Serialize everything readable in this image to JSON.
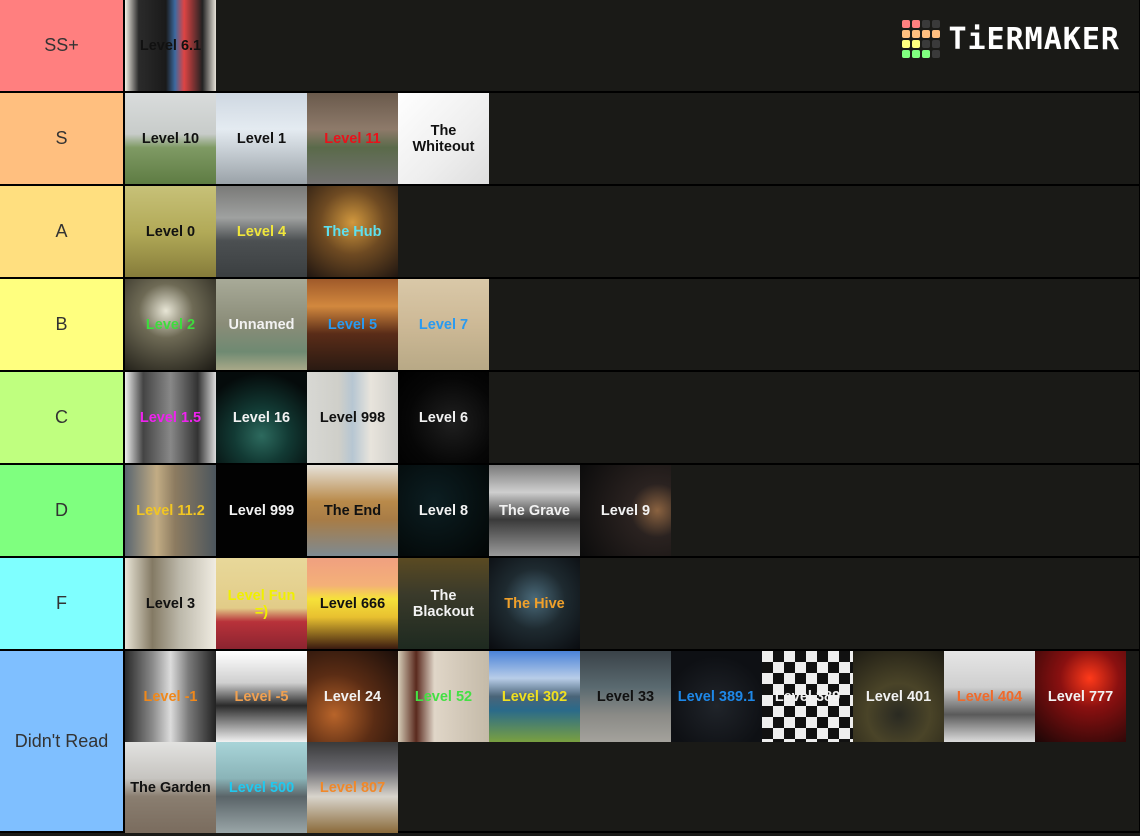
{
  "logo": {
    "text": "TiERMAKER",
    "grid_colors": [
      "#ff7f7f",
      "#ff7f7f",
      "#3a3a3a",
      "#3a3a3a",
      "#ffbf7f",
      "#ffbf7f",
      "#ffbf7f",
      "#ffbf7f",
      "#ffff7f",
      "#ffff7f",
      "#3a3a3a",
      "#3a3a3a",
      "#7fff7f",
      "#7fff7f",
      "#7fff7f",
      "#3a3a3a"
    ]
  },
  "tiers": [
    {
      "label": "SS+",
      "color": "#ff7f7f",
      "items": [
        {
          "name": "Level 6.1",
          "text_color": "#111111",
          "bg": "linear-gradient(90deg,#f3efe6 0%,#2b2b2b 15%,#1a1a1a 45%,#3c6aa0 55%,#d44 65%,#222 85%,#e6e2d8 100%)"
        }
      ]
    },
    {
      "label": "S",
      "color": "#ffbf7f",
      "items": [
        {
          "name": "Level 10",
          "text_color": "#111111",
          "bg": "linear-gradient(180deg,#d9dcdc 0%,#c8ccca 45%,#7f9a64 60%,#5e7c43 100%)"
        },
        {
          "name": "Level 1",
          "text_color": "#111111",
          "bg": "linear-gradient(180deg,#cfd8e2 0%,#e4ebf1 40%,#9aa2a8 100%)"
        },
        {
          "name": "Level 11",
          "text_color": "#e8121b",
          "bg": "linear-gradient(180deg,#6a5a4c 0%,#8e7a6a 40%,#5a6a4a 60%,#737171 100%)"
        },
        {
          "name": "The\nWhiteout",
          "text_color": "#111111",
          "bg": "linear-gradient(135deg,#ffffff 0%,#eeeeee 60%,#dedede 100%)"
        }
      ]
    },
    {
      "label": "A",
      "color": "#ffdf7f",
      "items": [
        {
          "name": "Level 0",
          "text_color": "#111111",
          "bg": "linear-gradient(180deg,#c7c178 0%,#b2aa58 50%,#867c3a 100%)"
        },
        {
          "name": "Level 4",
          "text_color": "#f0e63c",
          "bg": "linear-gradient(180deg,#7a7a78 0%,#9fa1a0 35%,#4c5052 60%,#3b3f41 100%)"
        },
        {
          "name": "The Hub",
          "text_color": "#5ee0ee",
          "bg": "radial-gradient(circle at 50% 40%,#d1983e 0%,#6e4a22 45%,#201611 100%)"
        }
      ]
    },
    {
      "label": "B",
      "color": "#ffff7f",
      "items": [
        {
          "name": "Level 2",
          "text_color": "#3ddc3d",
          "bg": "radial-gradient(circle at 45% 35%,#e8e6d6 0%,#6e6a55 35%,#1c1a14 100%)"
        },
        {
          "name": "Unnamed",
          "text_color": "#f2f2f2",
          "bg": "linear-gradient(180deg,#a8aa98 0%,#8a8c78 50%,#6f8a72 80%,#a8a888 100%)"
        },
        {
          "name": "Level 5",
          "text_color": "#2a9af0",
          "bg": "linear-gradient(180deg,#a05a2a 0%,#d2883e 30%,#5a2c18 60%,#2a1a12 100%)"
        },
        {
          "name": "Level 7",
          "text_color": "#2a9af0",
          "bg": "linear-gradient(180deg,#d9c8a8 0%,#cdb996 50%,#b8a986 100%)"
        }
      ]
    },
    {
      "label": "C",
      "color": "#bfff7f",
      "items": [
        {
          "name": "Level 1.5",
          "text_color": "#ee22ee",
          "bg": "linear-gradient(90deg,#eeeeee 0%,#444 20%,#888 50%,#333 80%,#ddd 100%)"
        },
        {
          "name": "Level 16",
          "text_color": "#f2f2f2",
          "bg": "radial-gradient(circle at 50% 70%,#2d6a5e 0%,#123a34 35%,#050b0b 80%)"
        },
        {
          "name": "Level 998",
          "text_color": "#111111",
          "bg": "linear-gradient(90deg,#d8d8d4 0%,#cfcfc9 35%,#b6c6d2 50%,#e8e4dc 70%,#cfcfcb 100%)"
        },
        {
          "name": "Level 6",
          "text_color": "#f2f2f2",
          "bg": "radial-gradient(circle at 60% 55%,#1f1f1f 0%,#060606 60%,#000 100%)"
        }
      ]
    },
    {
      "label": "D",
      "color": "#7fff7f",
      "items": [
        {
          "name": "Level 11.2",
          "text_color": "#f2c622",
          "bg": "linear-gradient(90deg,#5a6670 0%,#c2ac84 35%,#8c7b60 55%,#4c565e 100%)"
        },
        {
          "name": "Level 999",
          "text_color": "#f2f2f2",
          "bg": "#020202"
        },
        {
          "name": "The End",
          "text_color": "#111111",
          "bg": "linear-gradient(180deg,#e6e2da 0%,#b98a4a 40%,#a87c46 60%,#7e8a92 100%)"
        },
        {
          "name": "Level 8",
          "text_color": "#f2f2f2",
          "bg": "radial-gradient(circle at 40% 40%,#0c1e22 0%,#060f10 60%,#020505 100%)"
        },
        {
          "name": "The Grave",
          "text_color": "#f2f2f2",
          "bg": "linear-gradient(180deg,#7a7a7a 0%,#cfcfcf 30%,#3a3a3a 60%,#9a9a9a 100%)"
        },
        {
          "name": "Level 9",
          "text_color": "#f2f2f2",
          "bg": "radial-gradient(circle at 85% 50%,#8a6240 0%,#2a2220 30%,#0c0c0c 100%)"
        }
      ]
    },
    {
      "label": "F",
      "color": "#7fffff",
      "items": [
        {
          "name": "Level 3",
          "text_color": "#111111",
          "bg": "linear-gradient(90deg,#e8e4d6 0%,#847a64 30%,#bcb8aa 60%,#f0ece2 100%)"
        },
        {
          "name": "Level Fun\n=)",
          "text_color": "#f0f000",
          "bg": "linear-gradient(180deg,#e8d89a 0%,#e2cc88 55%,#b8323a 70%,#8c2430 100%)"
        },
        {
          "name": "Level 666",
          "text_color": "#111111",
          "bg": "linear-gradient(180deg,#f0a080 0%,#f4b078 30%,#f6e23a 45%,#e8c030 65%,#3a1a10 100%)"
        },
        {
          "name": "The\nBlackout",
          "text_color": "#f2f2f2",
          "bg": "linear-gradient(180deg,#5a4a22 0%,#3a3a2a 40%,#1e2a20 100%)"
        },
        {
          "name": "The Hive",
          "text_color": "#f0a02a",
          "bg": "radial-gradient(circle at 50% 45%,#4a6a7a 0%,#1e2a30 45%,#0a0c10 100%)"
        }
      ]
    },
    {
      "label": "Didn't Read",
      "color": "#7fbfff",
      "items": [
        {
          "name": "Level -1",
          "text_color": "#f0881a",
          "bg": "linear-gradient(90deg,#2a2a2a 0%,#8a8a8a 30%,#dcdcdc 50%,#7a7a7a 70%,#222 100%)"
        },
        {
          "name": "Level -5",
          "text_color": "#f0a050",
          "bg": "linear-gradient(180deg,#ffffff 0%,#cfcfcf 35%,#2a2a2a 60%,#f2f2f2 100%)"
        },
        {
          "name": "Level 24",
          "text_color": "#f2f2f2",
          "bg": "radial-gradient(circle at 30% 70%,#b8642a 0%,#5a2c14 45%,#1a0e0a 100%)"
        },
        {
          "name": "Level 52",
          "text_color": "#44e044",
          "bg": "linear-gradient(90deg,#d6cdb8 0%,#5a2a1e 20%,#e0d6c8 40%,#c4baa8 100%)"
        },
        {
          "name": "Level 302",
          "text_color": "#f0e020",
          "bg": "linear-gradient(180deg,#4a82d8 0%,#b8cde8 30%,#4a6478 50%,#2a6a8a 65%,#7aa040 100%)"
        },
        {
          "name": "Level 33",
          "text_color": "#111111",
          "bg": "linear-gradient(180deg,#3a4248 0%,#5a6a70 40%,#8a8a86 70%,#a4a29c 100%)"
        },
        {
          "name": "Level 389.1",
          "text_color": "#1e88e8",
          "bg": "radial-gradient(circle at 50% 60%,#20242a 0%,#0e1014 70%)"
        },
        {
          "name": "Level 389",
          "text_color": "#f2f2f2",
          "bg": "repeating-conic-gradient(#111 0% 25%, #eee 0% 50%) 0 0/22px 22px"
        },
        {
          "name": "Level 401",
          "text_color": "#f2f2f2",
          "bg": "radial-gradient(circle at 50% 70%,#2a2a22 0%,#4a4428 40%,#1e1c14 100%)"
        },
        {
          "name": "Level 404",
          "text_color": "#f06a2a",
          "bg": "linear-gradient(180deg,#e6e6e6 0%,#cfcfcf 40%,#5a5a5a 70%,#dcdcdc 100%)"
        },
        {
          "name": "Level 777",
          "text_color": "#f2f2f2",
          "bg": "radial-gradient(circle at 60% 30%,#ff3a1a 0%,#8a1010 35%,#1a0606 100%)"
        },
        {
          "name": "The Garden",
          "text_color": "#111111",
          "bg": "linear-gradient(180deg,#e2e2e0 0%,#c6c4c0 40%,#8a7e70 60%,#7a6c5e 100%)"
        },
        {
          "name": "Level 500",
          "text_color": "#22c8ee",
          "bg": "linear-gradient(180deg,#a8d4d8 0%,#8ab4b8 40%,#5a6468 60%,#9aa6a8 100%)"
        },
        {
          "name": "Level 807",
          "text_color": "#f0882a",
          "bg": "linear-gradient(180deg,#3a3a3a 0%,#6a6a70 30%,#d8d4cc 60%,#8a6a3a 100%)"
        }
      ]
    }
  ]
}
